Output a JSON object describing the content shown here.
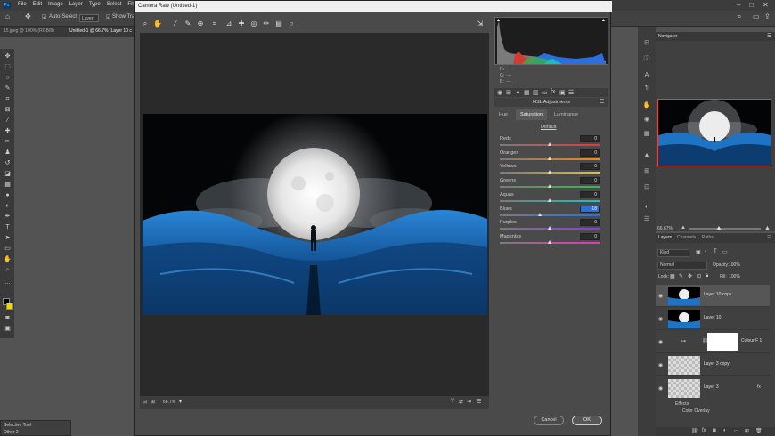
{
  "menubar": {
    "logo": "Ps",
    "items": [
      "File",
      "Edit",
      "Image",
      "Layer",
      "Type",
      "Select",
      "Filter"
    ],
    "window_controls": [
      "–",
      "□",
      "✕"
    ]
  },
  "options_bar": {
    "auto_select_label": "Auto-Select:",
    "auto_select_value": "Layer",
    "show_transform_label": "Show Trans"
  },
  "tabs": {
    "tab1": "15.jpeg @ 100% (RGB/8)",
    "tab2": "Untitled-1 @ 66.7% (Layer 10 c"
  },
  "camera_raw": {
    "title": "Camera Raw (Untitled-1)",
    "zoom": "66.7%",
    "rgb": {
      "r": "R:",
      "g": "G:",
      "b": "B:",
      "r_val": "---",
      "g_val": "---",
      "b_val": "---"
    },
    "panel_title": "HSL Adjustments",
    "subtabs": [
      "Hue",
      "Saturation",
      "Luminance"
    ],
    "active_subtab": "Saturation",
    "default_link": "Default",
    "sliders": [
      {
        "label": "Reds",
        "value": "0",
        "level": 0
      },
      {
        "label": "Oranges",
        "value": "0",
        "level": 0
      },
      {
        "label": "Yellows",
        "value": "0",
        "level": 0
      },
      {
        "label": "Greens",
        "value": "0",
        "level": 0
      },
      {
        "label": "Aquas",
        "value": "0",
        "level": 0
      },
      {
        "label": "Blues",
        "value": "-18",
        "level": -18
      },
      {
        "label": "Purples",
        "value": "0",
        "level": 0
      },
      {
        "label": "Magentas",
        "value": "0",
        "level": 0
      }
    ],
    "cancel": "Cancel",
    "ok": "OK"
  },
  "selective": {
    "title": "Selective Tool",
    "item": "Other 2"
  },
  "navigator": {
    "title": "Navigator",
    "zoom": "66.67%"
  },
  "layers": {
    "tabs": [
      "Layers",
      "Channels",
      "Paths"
    ],
    "kind": "Kind",
    "blend_mode": "Normal",
    "opacity_label": "Opacity:",
    "opacity": "100%",
    "lock_label": "Lock:",
    "fill_label": "Fill:",
    "fill": "100%",
    "rows": [
      "Layer 10 copy",
      "Layer 10",
      "Colour F 1",
      "Layer 3 copy",
      "Layer 3"
    ],
    "effects_label": "Effects",
    "color_overlay_label": "Color Overlay",
    "fx": "fx"
  },
  "icons": {
    "home": "home-icon",
    "move": "move-icon",
    "zoom": "zoom-icon",
    "hand": "hand-icon",
    "eye": "eye-icon"
  },
  "colors": {
    "accent_blue": "#2f6fd8",
    "nav_border": "#e0463a",
    "cr_bg": "#4a4a4a"
  }
}
